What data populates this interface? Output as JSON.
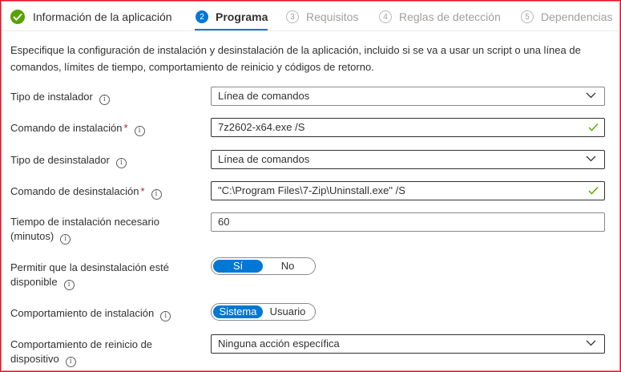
{
  "steps": [
    {
      "label": "Información de la aplicación",
      "state": "done"
    },
    {
      "number": "2",
      "label": "Programa",
      "state": "active"
    },
    {
      "number": "3",
      "label": "Requisitos",
      "state": "pending"
    },
    {
      "number": "4",
      "label": "Reglas de detección",
      "state": "pending"
    },
    {
      "number": "5",
      "label": "Dependencias",
      "state": "pending"
    }
  ],
  "description": "Especifique la configuración de instalación y desinstalación de la aplicación, incluido si se va a usar un script o una línea de comandos, límites de tiempo, comportamiento de reinicio y códigos de retorno.",
  "form": {
    "installer_type": {
      "label": "Tipo de instalador",
      "value": "Línea de comandos"
    },
    "install_command": {
      "label": "Comando de instalación",
      "required_mark": "*",
      "value": "7z2602-x64.exe /S"
    },
    "uninstaller_type": {
      "label": "Tipo de desinstalador",
      "value": "Línea de comandos"
    },
    "uninstall_command": {
      "label": "Comando de desinstalación",
      "required_mark": "*",
      "value": "\"C:\\Program Files\\7-Zip\\Uninstall.exe\" /S"
    },
    "install_time": {
      "label_line1": "Tiempo de instalación necesario",
      "label_line2": "(minutos)",
      "value": "60"
    },
    "allow_uninstall": {
      "label_line1": "Permitir que la desinstalación esté",
      "label_line2": "disponible",
      "options": [
        "Sí",
        "No"
      ],
      "selected": "Sí"
    },
    "install_behavior": {
      "label": "Comportamiento de instalación",
      "options": [
        "Sistema",
        "Usuario"
      ],
      "selected": "Sistema"
    },
    "restart_behavior": {
      "label_line1": "Comportamiento de reinicio de",
      "label_line2": "dispositivo",
      "value": "Ninguna acción específica"
    }
  },
  "colors": {
    "accent": "#0078d4",
    "success": "#57a300",
    "required": "#a4262c",
    "frame": "#e81123"
  },
  "icons": {
    "info": "info-icon",
    "chevron": "chevron-down-icon",
    "check": "checkmark-icon"
  }
}
